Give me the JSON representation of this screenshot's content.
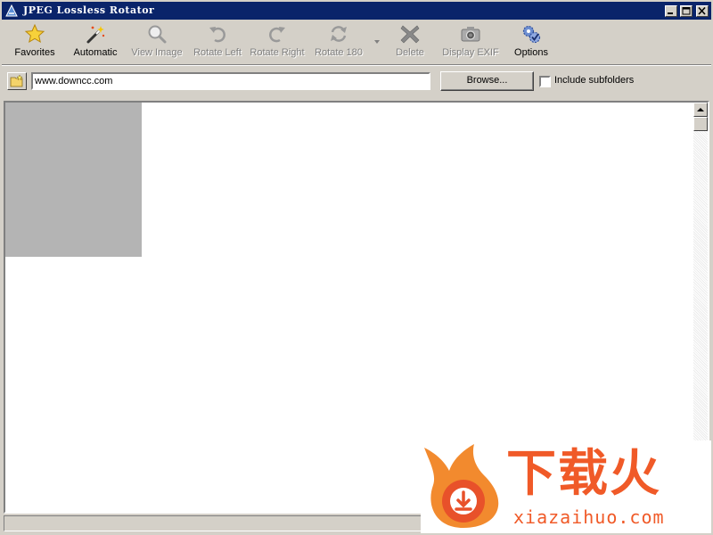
{
  "window": {
    "title": "JPEG Lossless Rotator",
    "title_bg": "#0a246a",
    "face_color": "#d4d0c8"
  },
  "toolbar": {
    "favorites": {
      "label": "Favorites",
      "icon": "star-icon",
      "enabled": true
    },
    "automatic": {
      "label": "Automatic",
      "icon": "magic-wand-icon",
      "enabled": true
    },
    "view_image": {
      "label": "View Image",
      "icon": "magnifier-icon",
      "enabled": false
    },
    "rotate_left": {
      "label": "Rotate Left",
      "icon": "rotate-left-icon",
      "enabled": false
    },
    "rotate_right": {
      "label": "Rotate Right",
      "icon": "rotate-right-icon",
      "enabled": false
    },
    "rotate_180": {
      "label": "Rotate 180",
      "icon": "rotate-180-icon",
      "enabled": false
    },
    "delete": {
      "label": "Delete",
      "icon": "delete-x-icon",
      "enabled": false
    },
    "display_exif": {
      "label": "Display EXIF",
      "icon": "camera-icon",
      "enabled": false
    },
    "options": {
      "label": "Options",
      "icon": "gears-icon",
      "enabled": true
    }
  },
  "address": {
    "path_value": "www.downcc.com",
    "browse_label": "Browse...",
    "include_subfolders_label": "Include subfolders",
    "include_subfolders_checked": false
  },
  "watermark": {
    "text_cn": "下载火",
    "text_en": "xiazaihuo.com",
    "color": "#f05a28"
  }
}
